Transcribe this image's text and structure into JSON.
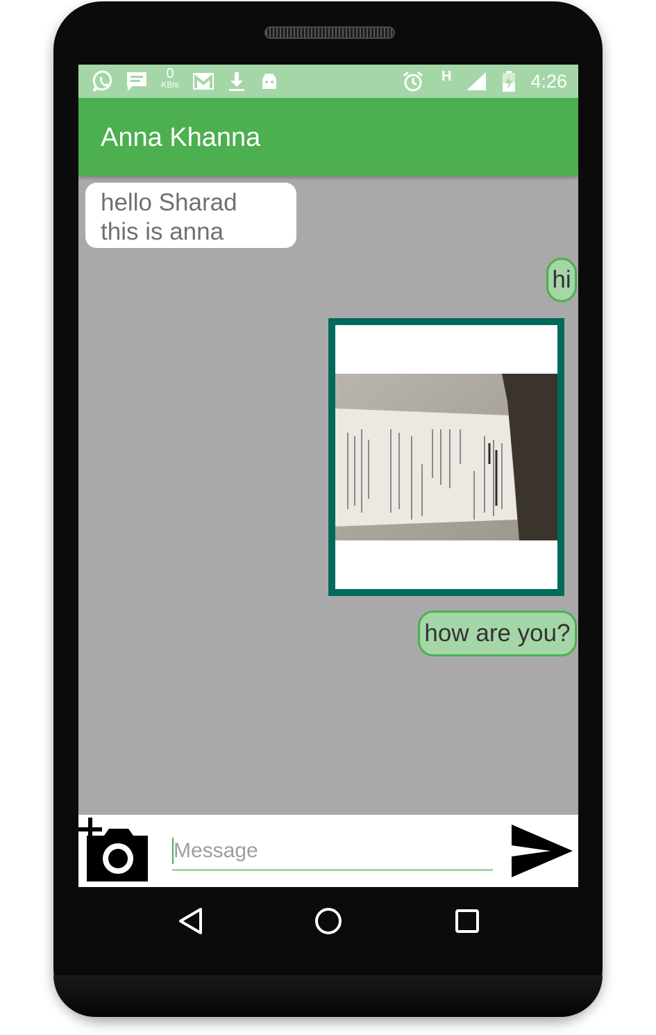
{
  "status_bar": {
    "icons": [
      "whatsapp-icon",
      "message-icon",
      "gmail-icon",
      "download-icon",
      "android-icon",
      "alarm-icon",
      "signal-icon",
      "battery-charging-icon"
    ],
    "network_speed_value": "0",
    "network_speed_unit": "KB/s",
    "network_type": "H",
    "time": "4:26"
  },
  "app_bar": {
    "title": "Anna Khanna"
  },
  "messages": [
    {
      "direction": "incoming",
      "type": "text",
      "text": "hello Sharad this is anna"
    },
    {
      "direction": "outgoing",
      "type": "text",
      "text": "hi"
    },
    {
      "direction": "outgoing",
      "type": "image",
      "content": "photo of a printed receipt"
    },
    {
      "direction": "outgoing",
      "type": "text",
      "text": "how are you?"
    }
  ],
  "composer": {
    "placeholder": "Message",
    "value": "",
    "attach_icon": "add-photo-camera-icon",
    "send_icon": "send-icon"
  },
  "nav_bar": {
    "icons": [
      "back-triangle-icon",
      "home-circle-icon",
      "recents-square-icon"
    ]
  },
  "colors": {
    "primary": "#4caf50",
    "status_bar": "#a5d6a7",
    "chat_background": "#a9a9a9",
    "outgoing_bubble": "#a5d6a7",
    "incoming_bubble": "#ffffff",
    "image_frame": "#006a5b"
  }
}
